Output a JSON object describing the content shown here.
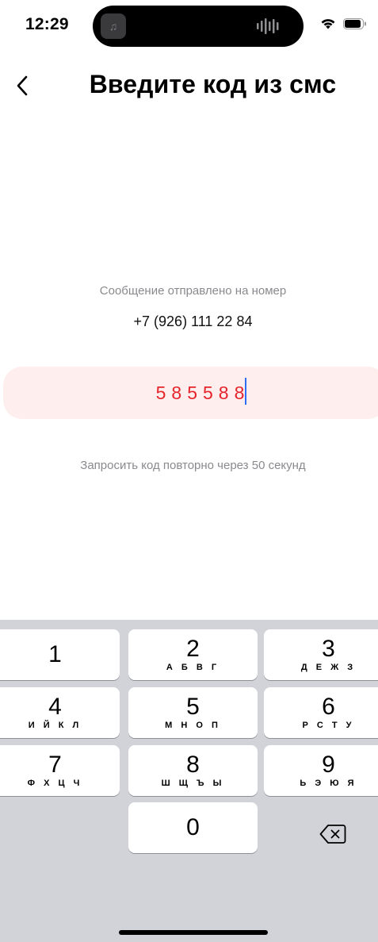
{
  "status_bar": {
    "time": "12:29"
  },
  "header": {
    "title": "Введите код из смс"
  },
  "verification": {
    "sent_label": "Сообщение отправлено на номер",
    "phone_number": "+7 (926) 111 22 84",
    "code": "585588",
    "resend_text": "Запросить код повторно через 50 секунд"
  },
  "keypad": {
    "keys": [
      {
        "num": "1",
        "letters": ""
      },
      {
        "num": "2",
        "letters": "А Б В Г"
      },
      {
        "num": "3",
        "letters": "Д Е Ж З"
      },
      {
        "num": "4",
        "letters": "И Й К Л"
      },
      {
        "num": "5",
        "letters": "М Н О П"
      },
      {
        "num": "6",
        "letters": "Р С Т У"
      },
      {
        "num": "7",
        "letters": "Ф Х Ц Ч"
      },
      {
        "num": "8",
        "letters": "Ш Щ Ъ Ы"
      },
      {
        "num": "9",
        "letters": "Ь Э Ю Я"
      },
      {
        "num": "0",
        "letters": ""
      }
    ]
  },
  "colors": {
    "accent_red": "#e5242b",
    "code_field_bg": "#ffeeee",
    "caret": "#2f6df6",
    "keypad_bg": "#d1d3d9"
  },
  "icons": [
    "back-chevron-icon",
    "wifi-icon",
    "battery-icon",
    "music-icon",
    "waveform-icon",
    "backspace-icon"
  ]
}
